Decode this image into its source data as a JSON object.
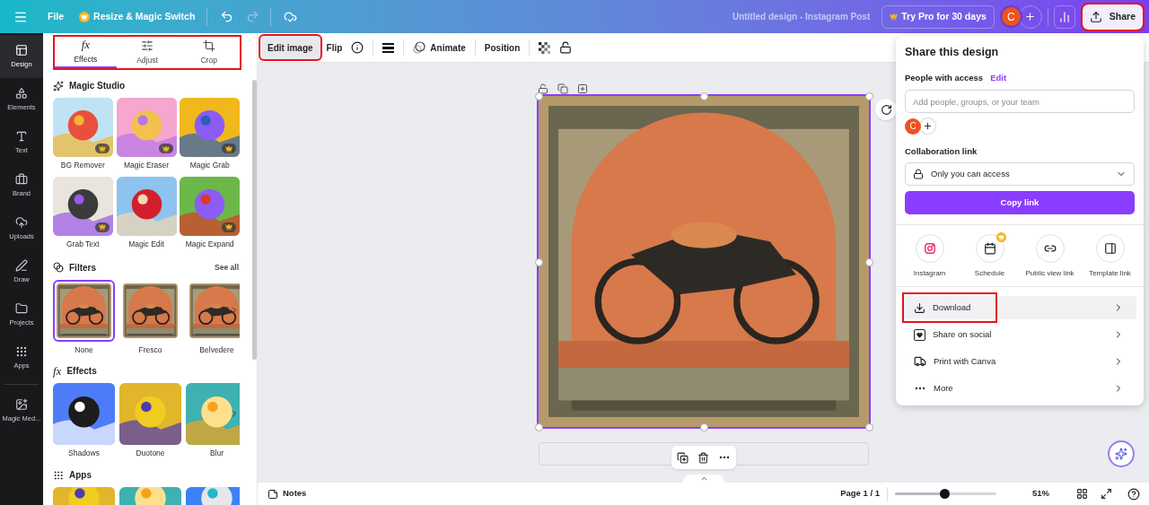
{
  "topbar": {
    "file": "File",
    "resize": "Resize & Magic Switch",
    "title": "Untitled design - Instagram Post",
    "pro": "Try Pro for 30 days",
    "avatar": "C",
    "share": {
      "label": "Share",
      "highlighted": true
    }
  },
  "rail": [
    {
      "label": "Design",
      "selected": true
    },
    {
      "label": "Elements",
      "selected": false
    },
    {
      "label": "Text",
      "selected": false
    },
    {
      "label": "Brand",
      "selected": false
    },
    {
      "label": "Uploads",
      "selected": false
    },
    {
      "label": "Draw",
      "selected": false
    },
    {
      "label": "Projects",
      "selected": false
    },
    {
      "label": "Apps",
      "selected": false
    },
    {
      "label": "Magic Med...",
      "selected": false
    }
  ],
  "edit_tabs": {
    "highlighted": true,
    "items": [
      {
        "label": "Effects",
        "glyph": "fx",
        "selected": true
      },
      {
        "label": "Adjust",
        "selected": false
      },
      {
        "label": "Crop",
        "selected": false
      }
    ]
  },
  "magic_studio": {
    "title": "Magic Studio",
    "tools": [
      {
        "label": "BG Remover",
        "pro": true
      },
      {
        "label": "Magic Eraser",
        "pro": true
      },
      {
        "label": "Magic Grab",
        "pro": true
      },
      {
        "label": "Grab Text",
        "pro": true
      },
      {
        "label": "Magic Edit",
        "pro": false
      },
      {
        "label": "Magic Expand",
        "pro": true
      }
    ]
  },
  "filters": {
    "title": "Filters",
    "see_all": "See all",
    "items": [
      {
        "label": "None",
        "selected": true
      },
      {
        "label": "Fresco",
        "selected": false
      },
      {
        "label": "Belvedere",
        "selected": false
      }
    ]
  },
  "effects": {
    "title": "Effects",
    "glyph": "fx",
    "items": [
      {
        "label": "Shadows"
      },
      {
        "label": "Duotone"
      },
      {
        "label": "Blur"
      }
    ]
  },
  "apps": {
    "title": "Apps"
  },
  "toolbar": {
    "edit_image": {
      "label": "Edit image",
      "highlighted": true
    },
    "flip": "Flip",
    "animate": "Animate",
    "position": "Position"
  },
  "share_panel": {
    "title": "Share this design",
    "access_label": "People with access",
    "edit_link": "Edit",
    "invite_placeholder": "Add people, groups, or your team",
    "avatar": "C",
    "collab_label": "Collaboration link",
    "access_select": "Only you can access",
    "copy_button": "Copy link",
    "targets": [
      {
        "label": "Instagram",
        "pro": false
      },
      {
        "label": "Schedule",
        "pro": true
      },
      {
        "label": "Public view link",
        "pro": false
      },
      {
        "label": "Template link",
        "pro": false
      }
    ],
    "actions": [
      {
        "label": "Download",
        "hovered": true,
        "highlighted": true
      },
      {
        "label": "Share on social",
        "hovered": false,
        "highlighted": false
      },
      {
        "label": "Print with Canva",
        "hovered": false,
        "highlighted": false
      },
      {
        "label": "More",
        "hovered": false,
        "highlighted": false
      }
    ]
  },
  "bottom": {
    "notes": "Notes",
    "page": "Page 1 / 1",
    "zoom": {
      "level": 0.49,
      "reading": "51%"
    }
  }
}
